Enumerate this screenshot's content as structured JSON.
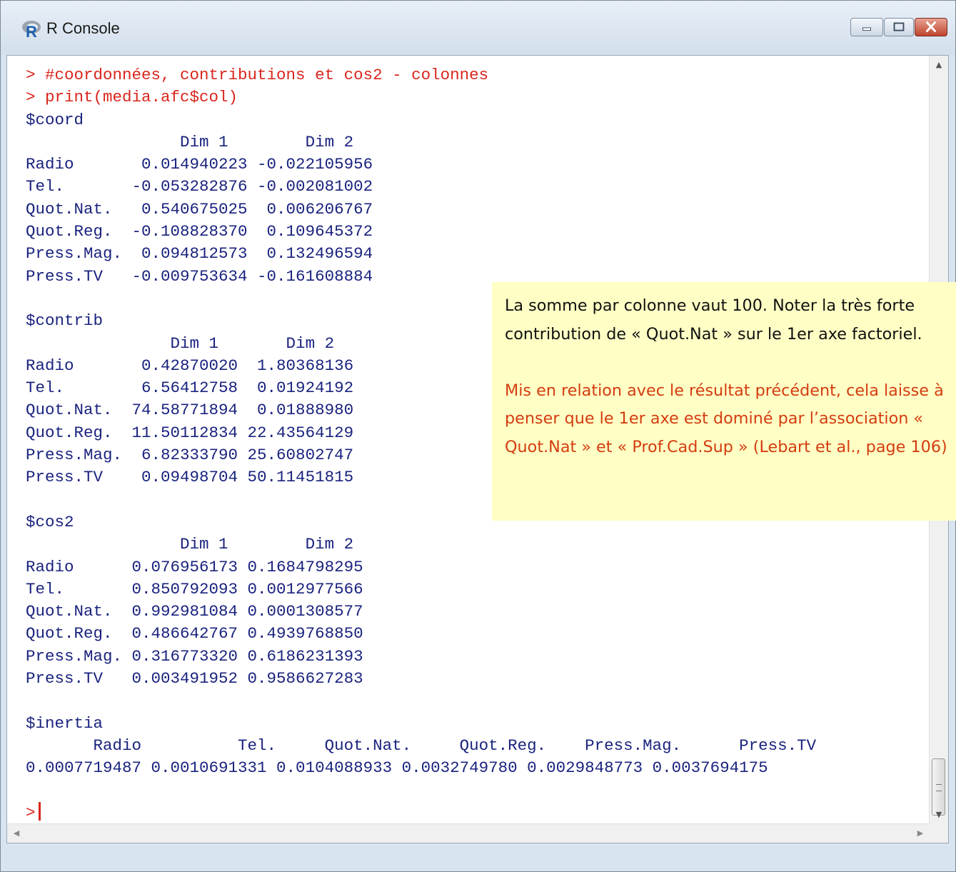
{
  "window": {
    "title": "R Console",
    "app_icon": "r-logo-icon"
  },
  "controls": {
    "minimize_icon": "minimize-icon",
    "maximize_icon": "maximize-icon",
    "close_icon": "close-icon"
  },
  "colors": {
    "command": "#d9261c",
    "output": "#1a237e",
    "note_bg": "#ffffc5",
    "note_highlight": "#d43c10"
  },
  "console": {
    "commands": [
      "> #coordonnées, contributions et cos2 - colonnes",
      "> print(media.afc$col)"
    ],
    "coord": {
      "title": "$coord",
      "header": "                Dim 1        Dim 2",
      "rows": [
        "Radio       0.014940223 -0.022105956",
        "Tel.       -0.053282876 -0.002081002",
        "Quot.Nat.   0.540675025  0.006206767",
        "Quot.Reg.  -0.108828370  0.109645372",
        "Press.Mag.  0.094812573  0.132496594",
        "Press.TV   -0.009753634 -0.161608884"
      ]
    },
    "contrib": {
      "title": "$contrib",
      "header": "               Dim 1       Dim 2",
      "rows": [
        "Radio       0.42870020  1.80368136",
        "Tel.        6.56412758  0.01924192",
        "Quot.Nat.  74.58771894  0.01888980",
        "Quot.Reg.  11.50112834 22.43564129",
        "Press.Mag.  6.82333790 25.60802747",
        "Press.TV    0.09498704 50.11451815"
      ]
    },
    "cos2": {
      "title": "$cos2",
      "header": "                Dim 1        Dim 2",
      "rows": [
        "Radio      0.076956173 0.1684798295",
        "Tel.       0.850792093 0.0012977566",
        "Quot.Nat.  0.992981084 0.0001308577",
        "Quot.Reg.  0.486642767 0.4939768850",
        "Press.Mag. 0.316773320 0.6186231393",
        "Press.TV   0.003491952 0.9586627283"
      ]
    },
    "inertia": {
      "title": "$inertia",
      "header": "       Radio          Tel.     Quot.Nat.     Quot.Reg.    Press.Mag.      Press.TV",
      "values": "0.0007719487 0.0010691331 0.0104088933 0.0032749780 0.0029848773 0.0037694175"
    },
    "prompt": ">"
  },
  "note": {
    "paragraph1": "La somme par colonne vaut 100. Noter la très forte contribution de « Quot.Nat » sur le 1er axe factoriel.",
    "paragraph2": "Mis en relation avec le résultat précédent, cela laisse à penser que le 1er axe est dominé par l’association « Quot.Nat » et « Prof.Cad.Sup » (Lebart et al., page 106)"
  }
}
